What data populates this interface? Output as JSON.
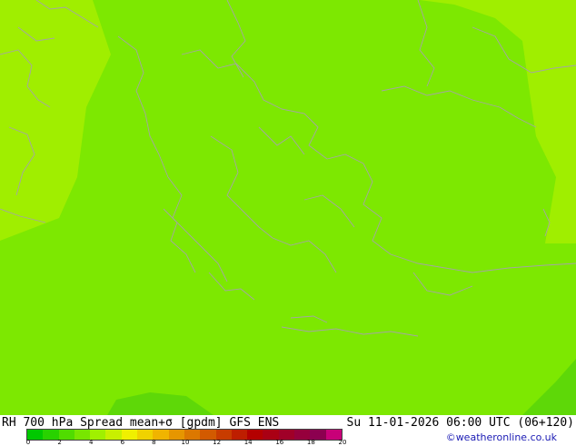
{
  "map": {
    "colors": {
      "main_fill": "#7de801",
      "light_fill": "#a0ee00",
      "dark_fill": "#5ed808",
      "border_line": "#a5a5a5"
    }
  },
  "footer": {
    "title": "RH 700 hPa Spread mean+σ [gpdm] GFS ENS",
    "valid_time": "Su 11-01-2026 06:00 UTC (06+120)",
    "credit": "©weatheronline.co.uk"
  },
  "legend": {
    "colors": [
      "#00c800",
      "#28d200",
      "#50dc00",
      "#78e600",
      "#a0f000",
      "#c8f000",
      "#f0f000",
      "#f0d200",
      "#f0b400",
      "#e69600",
      "#dc7800",
      "#d25a00",
      "#c83c00",
      "#be1e00",
      "#b40000",
      "#aa0014",
      "#a00028",
      "#96003c",
      "#8c0050",
      "#c80078"
    ],
    "labels": [
      "0",
      "2",
      "4",
      "6",
      "8",
      "10",
      "12",
      "14",
      "16",
      "18",
      "20"
    ]
  }
}
